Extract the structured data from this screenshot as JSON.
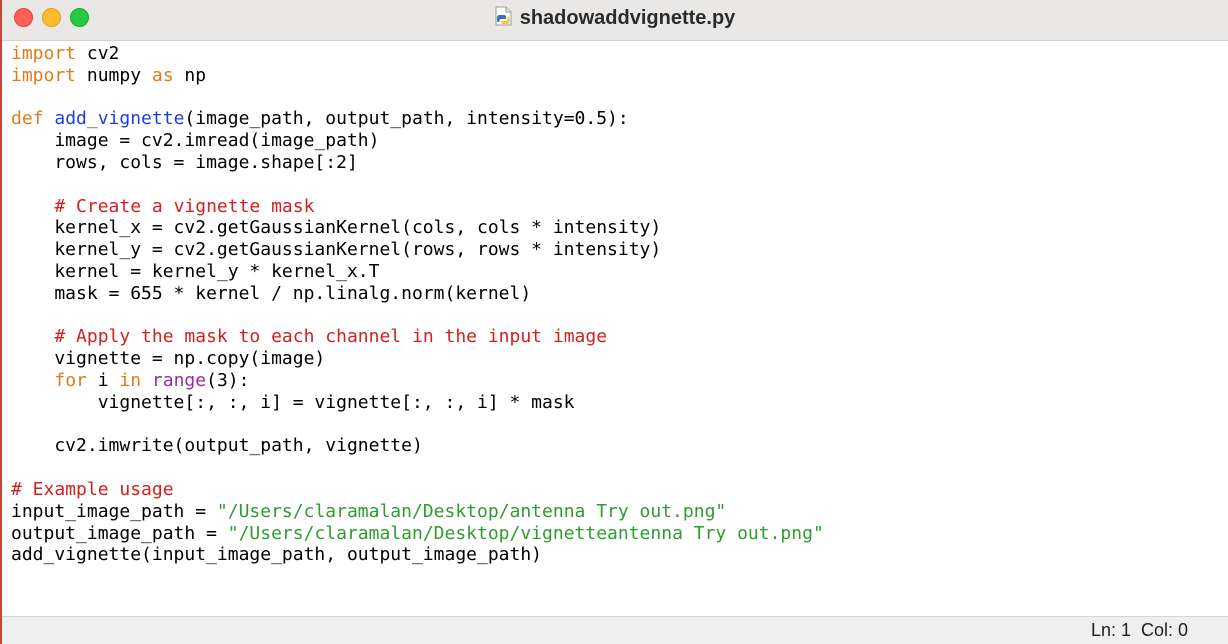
{
  "window": {
    "title": "shadowaddvignette.py",
    "file_icon": "python-file-icon"
  },
  "editor": {
    "lines": [
      [
        {
          "t": "import",
          "c": "kw"
        },
        {
          "t": " cv2",
          "c": ""
        }
      ],
      [
        {
          "t": "import",
          "c": "kw"
        },
        {
          "t": " numpy ",
          "c": ""
        },
        {
          "t": "as",
          "c": "kw"
        },
        {
          "t": " np",
          "c": ""
        }
      ],
      [],
      [
        {
          "t": "def",
          "c": "kw"
        },
        {
          "t": " ",
          "c": ""
        },
        {
          "t": "add_vignette",
          "c": "fn"
        },
        {
          "t": "(image_path, output_path, intensity=0.5):",
          "c": ""
        }
      ],
      [
        {
          "t": "    image = cv2.imread(image_path)",
          "c": ""
        }
      ],
      [
        {
          "t": "    rows, cols = image.shape[:2]",
          "c": ""
        }
      ],
      [],
      [
        {
          "t": "    ",
          "c": ""
        },
        {
          "t": "# Create a vignette mask",
          "c": "cm"
        }
      ],
      [
        {
          "t": "    kernel_x = cv2.getGaussianKernel(cols, cols * intensity)",
          "c": ""
        }
      ],
      [
        {
          "t": "    kernel_y = cv2.getGaussianKernel(rows, rows * intensity)",
          "c": ""
        }
      ],
      [
        {
          "t": "    kernel = kernel_y * kernel_x.T",
          "c": ""
        }
      ],
      [
        {
          "t": "    mask = 655 * kernel / np.linalg.norm(kernel)",
          "c": ""
        }
      ],
      [],
      [
        {
          "t": "    ",
          "c": ""
        },
        {
          "t": "# Apply the mask to each channel in the input image",
          "c": "cm"
        }
      ],
      [
        {
          "t": "    vignette = np.copy(image)",
          "c": ""
        }
      ],
      [
        {
          "t": "    ",
          "c": ""
        },
        {
          "t": "for",
          "c": "kw"
        },
        {
          "t": " i ",
          "c": ""
        },
        {
          "t": "in",
          "c": "kw"
        },
        {
          "t": " ",
          "c": ""
        },
        {
          "t": "range",
          "c": "bi"
        },
        {
          "t": "(3):",
          "c": ""
        }
      ],
      [
        {
          "t": "        vignette[:, :, i] = vignette[:, :, i] * mask",
          "c": ""
        }
      ],
      [],
      [
        {
          "t": "    cv2.imwrite(output_path, vignette)",
          "c": ""
        }
      ],
      [],
      [
        {
          "t": "# Example usage",
          "c": "cm"
        }
      ],
      [
        {
          "t": "input_image_path = ",
          "c": ""
        },
        {
          "t": "\"/Users/claramalan/Desktop/antenna Try out.png\"",
          "c": "st"
        }
      ],
      [
        {
          "t": "output_image_path = ",
          "c": ""
        },
        {
          "t": "\"/Users/claramalan/Desktop/vignetteantenna Try out.png\"",
          "c": "st"
        }
      ],
      [
        {
          "t": "add_vignette(input_image_path, output_image_path)",
          "c": ""
        }
      ]
    ]
  },
  "status": {
    "text": "Ln: 1  Col: 0"
  },
  "colors": {
    "keyword": "#e07b17",
    "function": "#1e3fd8",
    "builtin": "#9b2aa5",
    "comment": "#d21f1f",
    "string": "#2f9c2f"
  }
}
